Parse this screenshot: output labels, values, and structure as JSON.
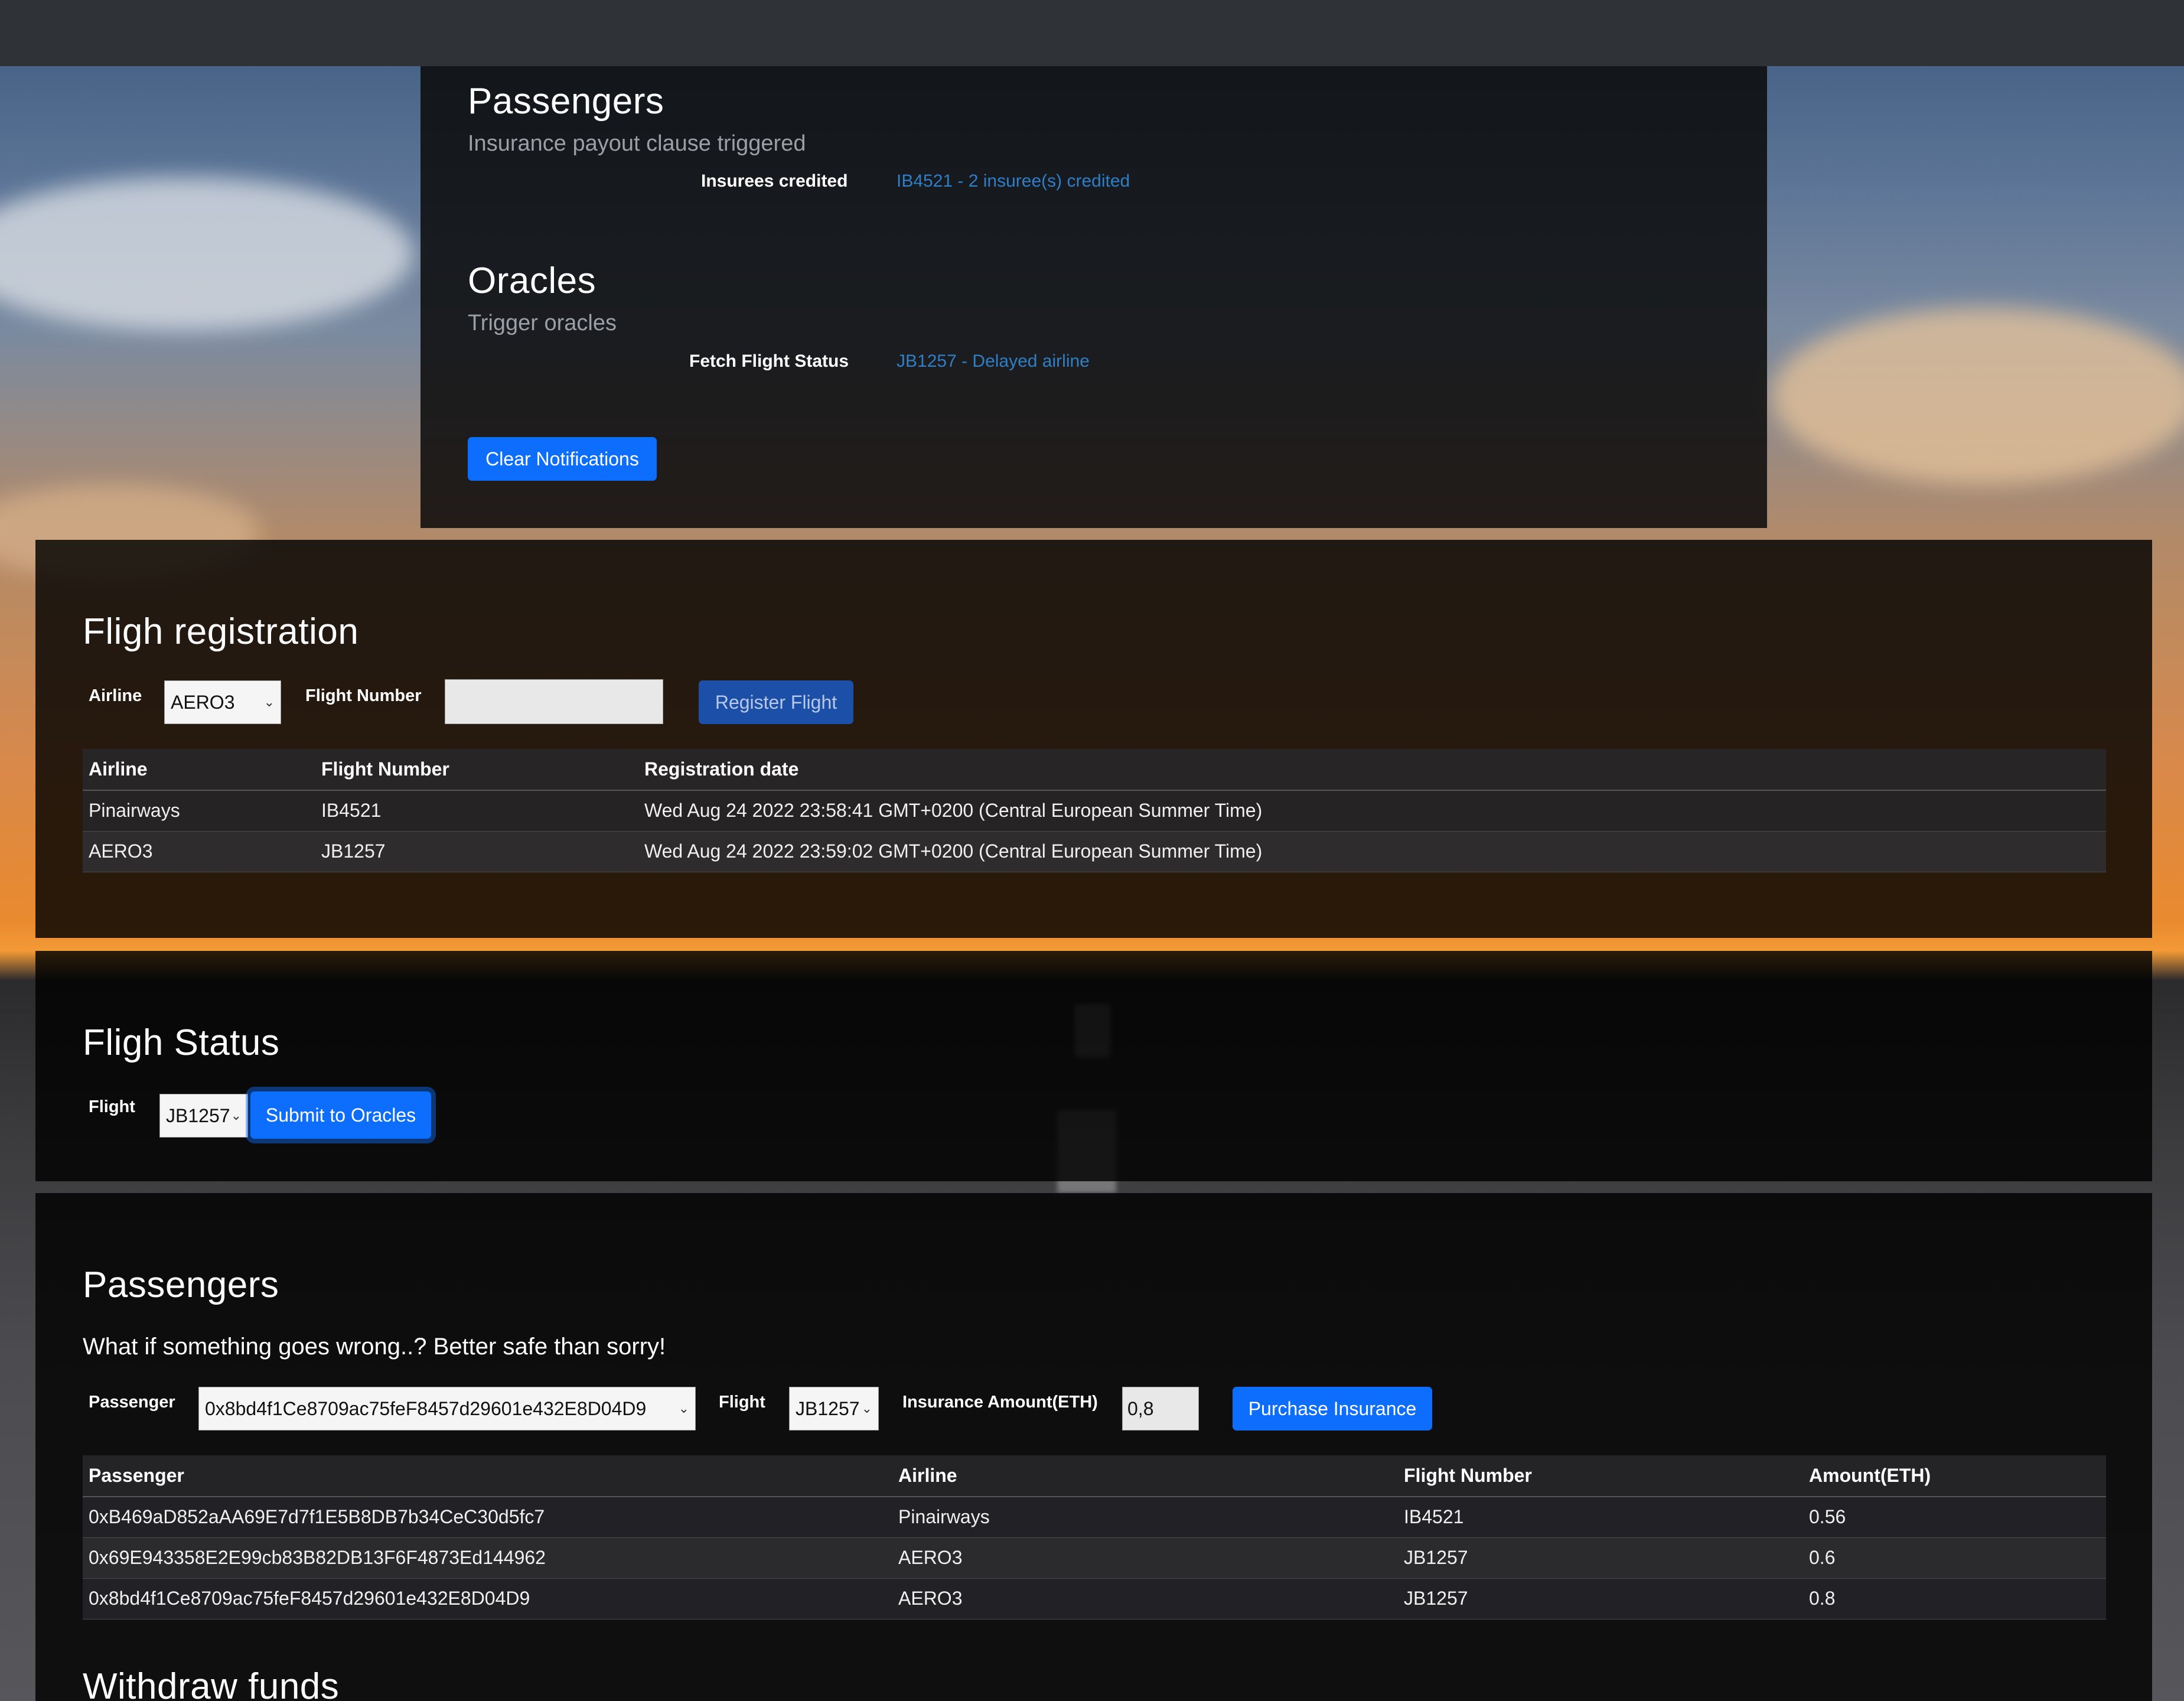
{
  "notifications": {
    "passengers": {
      "heading": "Passengers",
      "subtitle": "Insurance payout clause triggered",
      "label": "Insurees credited",
      "value": "IB4521 - 2 insuree(s) credited"
    },
    "oracles": {
      "heading": "Oracles",
      "subtitle": "Trigger oracles",
      "label": "Fetch Flight Status",
      "value": "JB1257 - Delayed airline"
    },
    "clear_label": "Clear Notifications"
  },
  "registration": {
    "heading": "Fligh registration",
    "airline_label": "Airline",
    "airline_selected": "AERO3",
    "flight_number_label": "Flight Number",
    "flight_number_value": "",
    "register_label": "Register Flight",
    "columns": [
      "Airline",
      "Flight Number",
      "Registration date"
    ],
    "rows": [
      [
        "Pinairways",
        "IB4521",
        "Wed Aug 24 2022 23:58:41 GMT+0200 (Central European Summer Time)"
      ],
      [
        "AERO3",
        "JB1257",
        "Wed Aug 24 2022 23:59:02 GMT+0200 (Central European Summer Time)"
      ]
    ]
  },
  "status": {
    "heading": "Fligh Status",
    "flight_label": "Flight",
    "flight_selected": "JB1257",
    "submit_label": "Submit to Oracles"
  },
  "passengers": {
    "heading": "Passengers",
    "lead": "What if something goes wrong..? Better safe than sorry!",
    "passenger_label": "Passenger",
    "passenger_selected": "0x8bd4f1Ce8709ac75feF8457d29601e432E8D04D9",
    "flight_label": "Flight",
    "flight_selected": "JB1257",
    "amount_label": "Insurance Amount(ETH)",
    "amount_value": "0,8",
    "purchase_label": "Purchase Insurance",
    "columns": [
      "Passenger",
      "Airline",
      "Flight Number",
      "Amount(ETH)"
    ],
    "rows": [
      [
        "0xB469aD852aAA69E7d7f1E5B8DB7b34CeC30d5fc7",
        "Pinairways",
        "IB4521",
        "0.56"
      ],
      [
        "0x69E943358E2E99cb83B82DB13F6F4873Ed144962",
        "AERO3",
        "JB1257",
        "0.6"
      ],
      [
        "0x8bd4f1Ce8709ac75feF8457d29601e432E8D04D9",
        "AERO3",
        "JB1257",
        "0.8"
      ]
    ]
  },
  "withdraw": {
    "heading": "Withdraw funds"
  }
}
